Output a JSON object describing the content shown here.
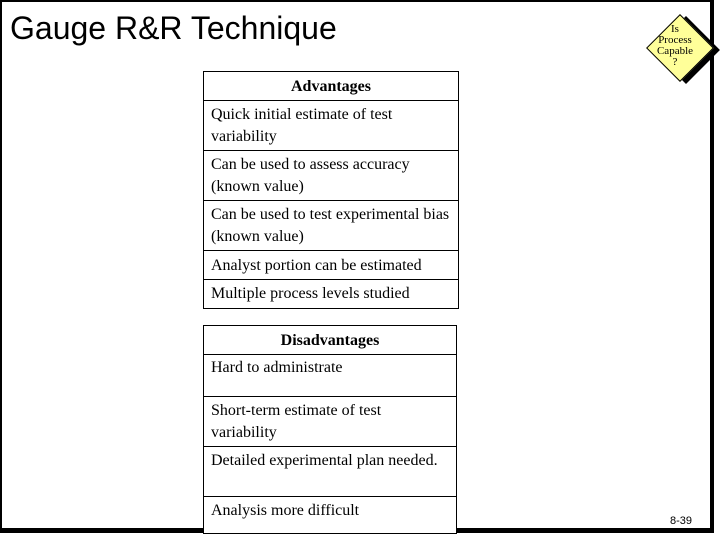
{
  "slide": {
    "title": "Gauge R&R Technique",
    "badge": {
      "icon": "decision-diamond-icon",
      "lines": [
        "Is",
        "Process",
        "Capable",
        "?"
      ],
      "fill_color": "#ffff99"
    },
    "advantages": {
      "header": "Advantages",
      "items": [
        "Quick initial estimate of test variability",
        "Can be used to assess accuracy (known value)",
        "Can be used to test experimental bias (known value)",
        "Analyst portion can be estimated",
        "Multiple process levels studied"
      ]
    },
    "disadvantages": {
      "header": "Disadvantages",
      "items": [
        "Hard to administrate",
        "Short-term estimate of test variability",
        "Detailed experimental plan needed.",
        "Analysis more difficult"
      ]
    },
    "page_number": "8-39"
  }
}
